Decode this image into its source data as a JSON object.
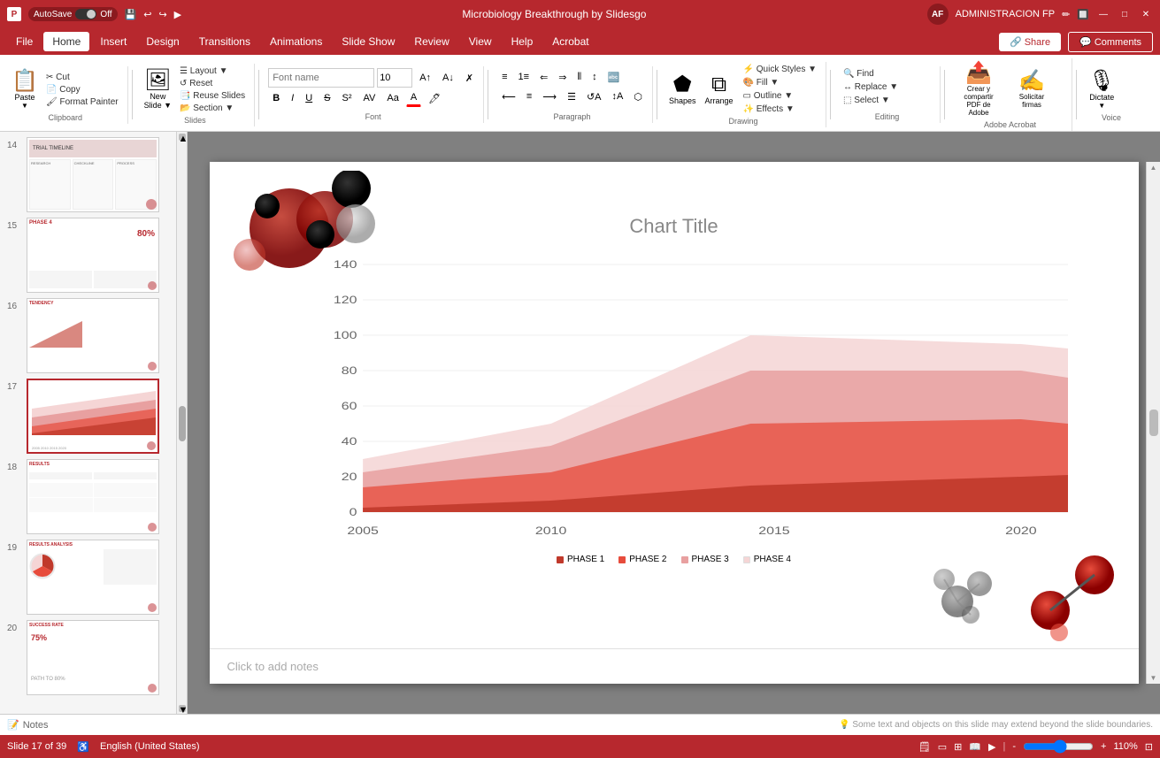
{
  "titlebar": {
    "autosave": "AutoSave",
    "autosave_state": "Off",
    "title": "Microbiology Breakthrough by Slidesgo",
    "user": "ADMINISTRACION FP",
    "avatar": "AF"
  },
  "menubar": {
    "items": [
      {
        "id": "file",
        "label": "File"
      },
      {
        "id": "home",
        "label": "Home",
        "active": true
      },
      {
        "id": "insert",
        "label": "Insert"
      },
      {
        "id": "design",
        "label": "Design"
      },
      {
        "id": "transitions",
        "label": "Transitions"
      },
      {
        "id": "animations",
        "label": "Animations"
      },
      {
        "id": "slideshow",
        "label": "Slide Show"
      },
      {
        "id": "review",
        "label": "Review"
      },
      {
        "id": "view",
        "label": "View"
      },
      {
        "id": "help",
        "label": "Help"
      },
      {
        "id": "acrobat",
        "label": "Acrobat"
      }
    ]
  },
  "ribbon": {
    "groups": {
      "clipboard": {
        "label": "Clipboard",
        "paste": "Paste",
        "cut": "Cut",
        "copy": "Copy",
        "format_painter": "Format Painter"
      },
      "slides": {
        "label": "Slides",
        "new_slide": "New Slide",
        "layout": "Layout",
        "reset": "Reset",
        "reuse_slides": "Reuse Slides",
        "section": "Section"
      },
      "font": {
        "label": "Font",
        "font_name": "",
        "font_size": "10",
        "bold": "B",
        "italic": "I",
        "underline": "U",
        "strikethrough": "S"
      },
      "paragraph": {
        "label": "Paragraph"
      },
      "drawing": {
        "label": "Drawing",
        "shapes": "Shapes",
        "arrange": "Arrange",
        "quick_styles": "Quick Styles",
        "select": "Select"
      },
      "editing": {
        "label": "Editing",
        "find": "Find",
        "replace": "Replace",
        "select": "Select"
      },
      "acrobat": {
        "label": "Adobe Acrobat",
        "create_pdf": "Crear y compartir PDF de Adobe",
        "request_sign": "Solicitar firmas",
        "share": "Share",
        "comments": "Comments"
      },
      "voice": {
        "label": "Voice",
        "dictate": "Dictate"
      }
    }
  },
  "slides": [
    {
      "num": 14,
      "label": "Slide 14"
    },
    {
      "num": 15,
      "label": "Slide 15"
    },
    {
      "num": 16,
      "label": "Slide 16"
    },
    {
      "num": 17,
      "label": "Slide 17",
      "active": true
    },
    {
      "num": 18,
      "label": "Slide 18"
    },
    {
      "num": 19,
      "label": "Slide 19"
    },
    {
      "num": 20,
      "label": "Slide 20"
    }
  ],
  "current_slide": {
    "chart_title": "Chart Title",
    "notes_placeholder": "Click to add notes",
    "legend": [
      {
        "id": "phase1",
        "label": "PHASE 1",
        "color": "#c0392b"
      },
      {
        "id": "phase2",
        "label": "PHASE 2",
        "color": "#e74c3c"
      },
      {
        "id": "phase3",
        "label": "PHASE 3",
        "color": "#e8a0a0"
      },
      {
        "id": "phase4",
        "label": "PHASE 4",
        "color": "#f2c8c8"
      }
    ],
    "yaxis": [
      "140",
      "120",
      "100",
      "80",
      "60",
      "40",
      "20",
      "0"
    ],
    "xaxis": [
      "2005",
      "2010",
      "2015",
      "2020"
    ]
  },
  "statusbar": {
    "slide_info": "Slide 17 of 39",
    "language": "English (United States)",
    "notes": "Notes",
    "zoom": "110%",
    "view_normal": "Normal",
    "view_slide_sorter": "Slide Sorter",
    "view_reading": "Reading View",
    "view_slideshow": "Slide Show"
  },
  "colors": {
    "brand": "#b7282e",
    "dark_red": "#8b1a1f",
    "phase1": "#8b1a1f",
    "phase2": "#c0392b",
    "phase3": "#e8a0a0",
    "phase4": "#f5d5d5"
  }
}
